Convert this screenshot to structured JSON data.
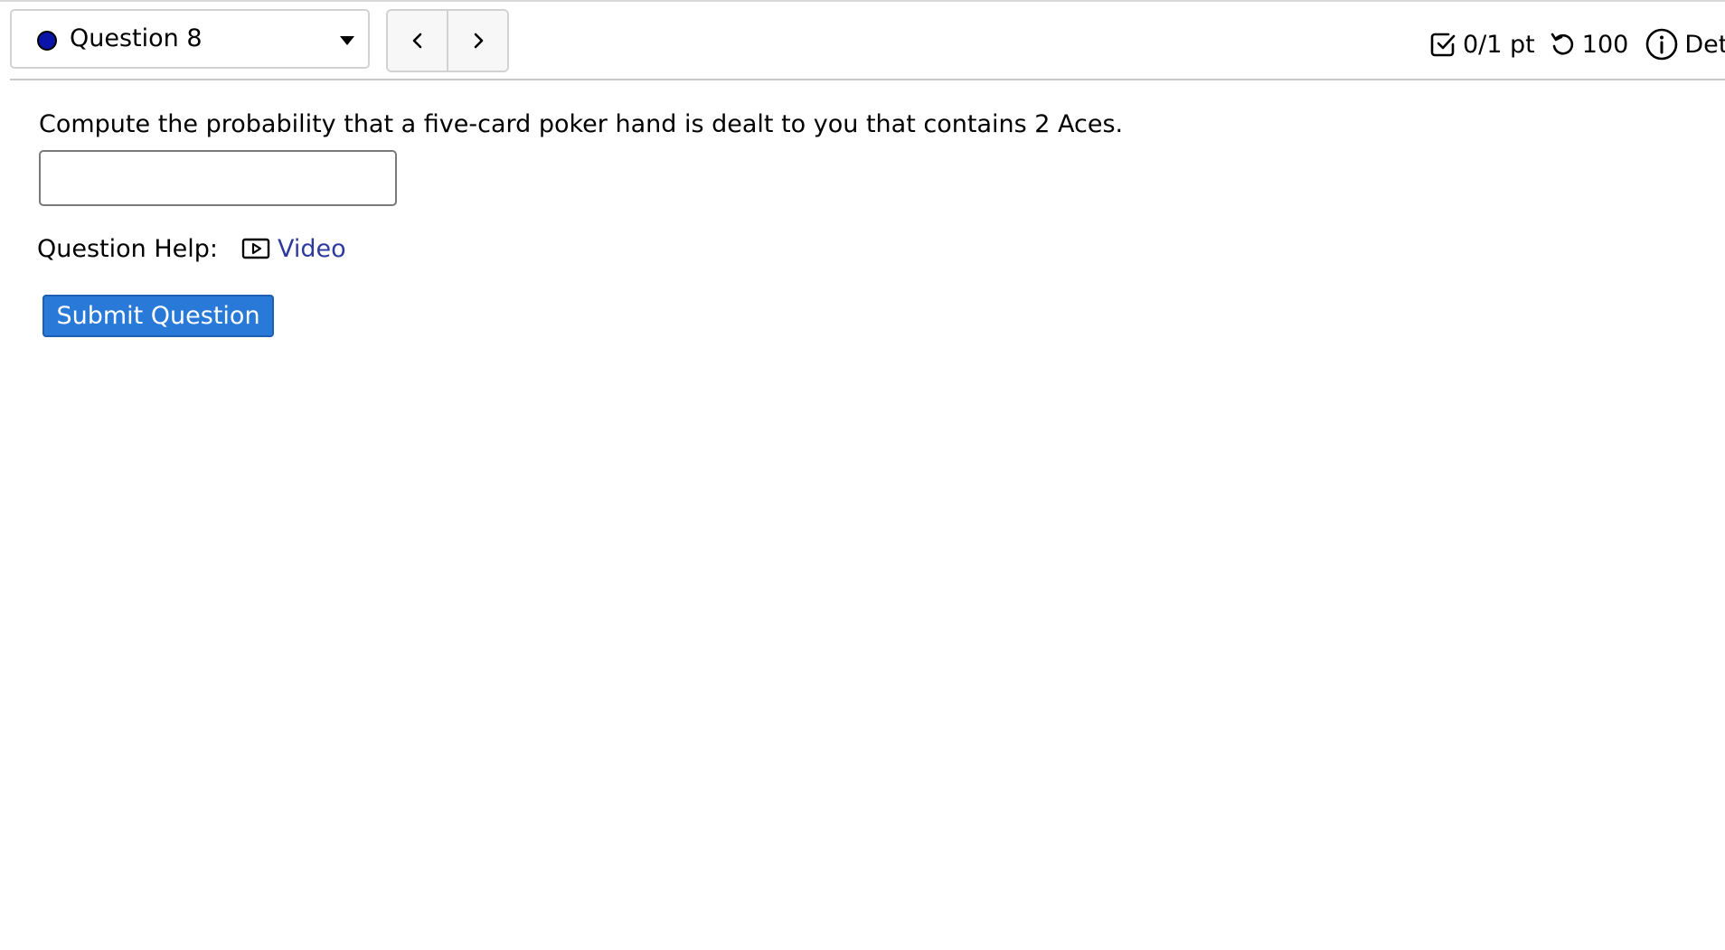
{
  "header": {
    "question_select": {
      "label": "Question 8",
      "status_color": "#0b14a8",
      "icon": "chevron-down-icon"
    },
    "nav": {
      "prev_icon": "chevron-left-icon",
      "next_icon": "chevron-right-icon"
    },
    "status": {
      "score": "0/1 pt",
      "attempts": "100",
      "details_label": "Det"
    }
  },
  "question": {
    "prompt": "Compute the probability that a five-card poker hand is dealt to you that contains 2 Aces.",
    "answer_value": "",
    "help_label": "Question Help:",
    "help_video_label": "Video",
    "submit_label": "Submit Question"
  },
  "colors": {
    "link": "#2e3a9e",
    "submit_bg": "#2879d8",
    "status_dot": "#0b14a8"
  }
}
